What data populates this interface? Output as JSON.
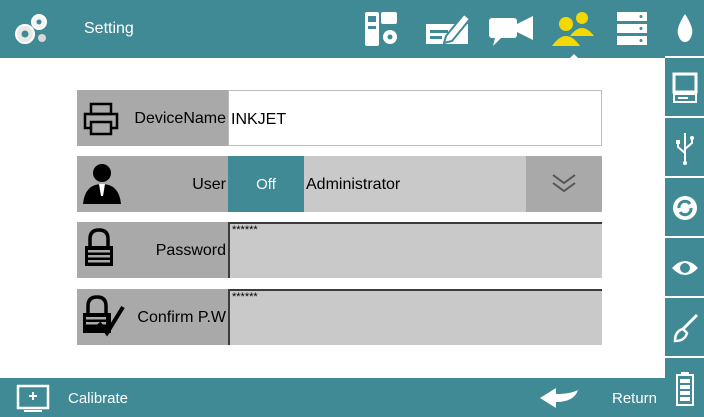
{
  "header": {
    "title": "Setting",
    "toolbar_icons": [
      {
        "name": "device-settings-icon",
        "active": false
      },
      {
        "name": "edit-document-icon",
        "active": false
      },
      {
        "name": "camera-icon",
        "active": false
      },
      {
        "name": "users-icon",
        "active": true
      },
      {
        "name": "server-icon",
        "active": false
      }
    ]
  },
  "sidebar": {
    "items": [
      "ink-drop-icon",
      "monitor-icon",
      "usb-icon",
      "refresh-icon",
      "eye-icon",
      "brush-icon",
      "battery-icon"
    ]
  },
  "form": {
    "device_name": {
      "label": "DeviceName",
      "value": "INKJET"
    },
    "user": {
      "label": "User",
      "toggle": "Off",
      "selected": "Administrator"
    },
    "password": {
      "label": "Password",
      "value": "******"
    },
    "confirm": {
      "label": "Confirm P.W",
      "value": "******"
    }
  },
  "footer": {
    "calibrate_label": "Calibrate",
    "return_label": "Return"
  },
  "colors": {
    "accent": "#3f8a94",
    "active_icon": "#f5d800",
    "label_bg": "#a9a9a9",
    "field_bg": "#c9c9c9"
  }
}
